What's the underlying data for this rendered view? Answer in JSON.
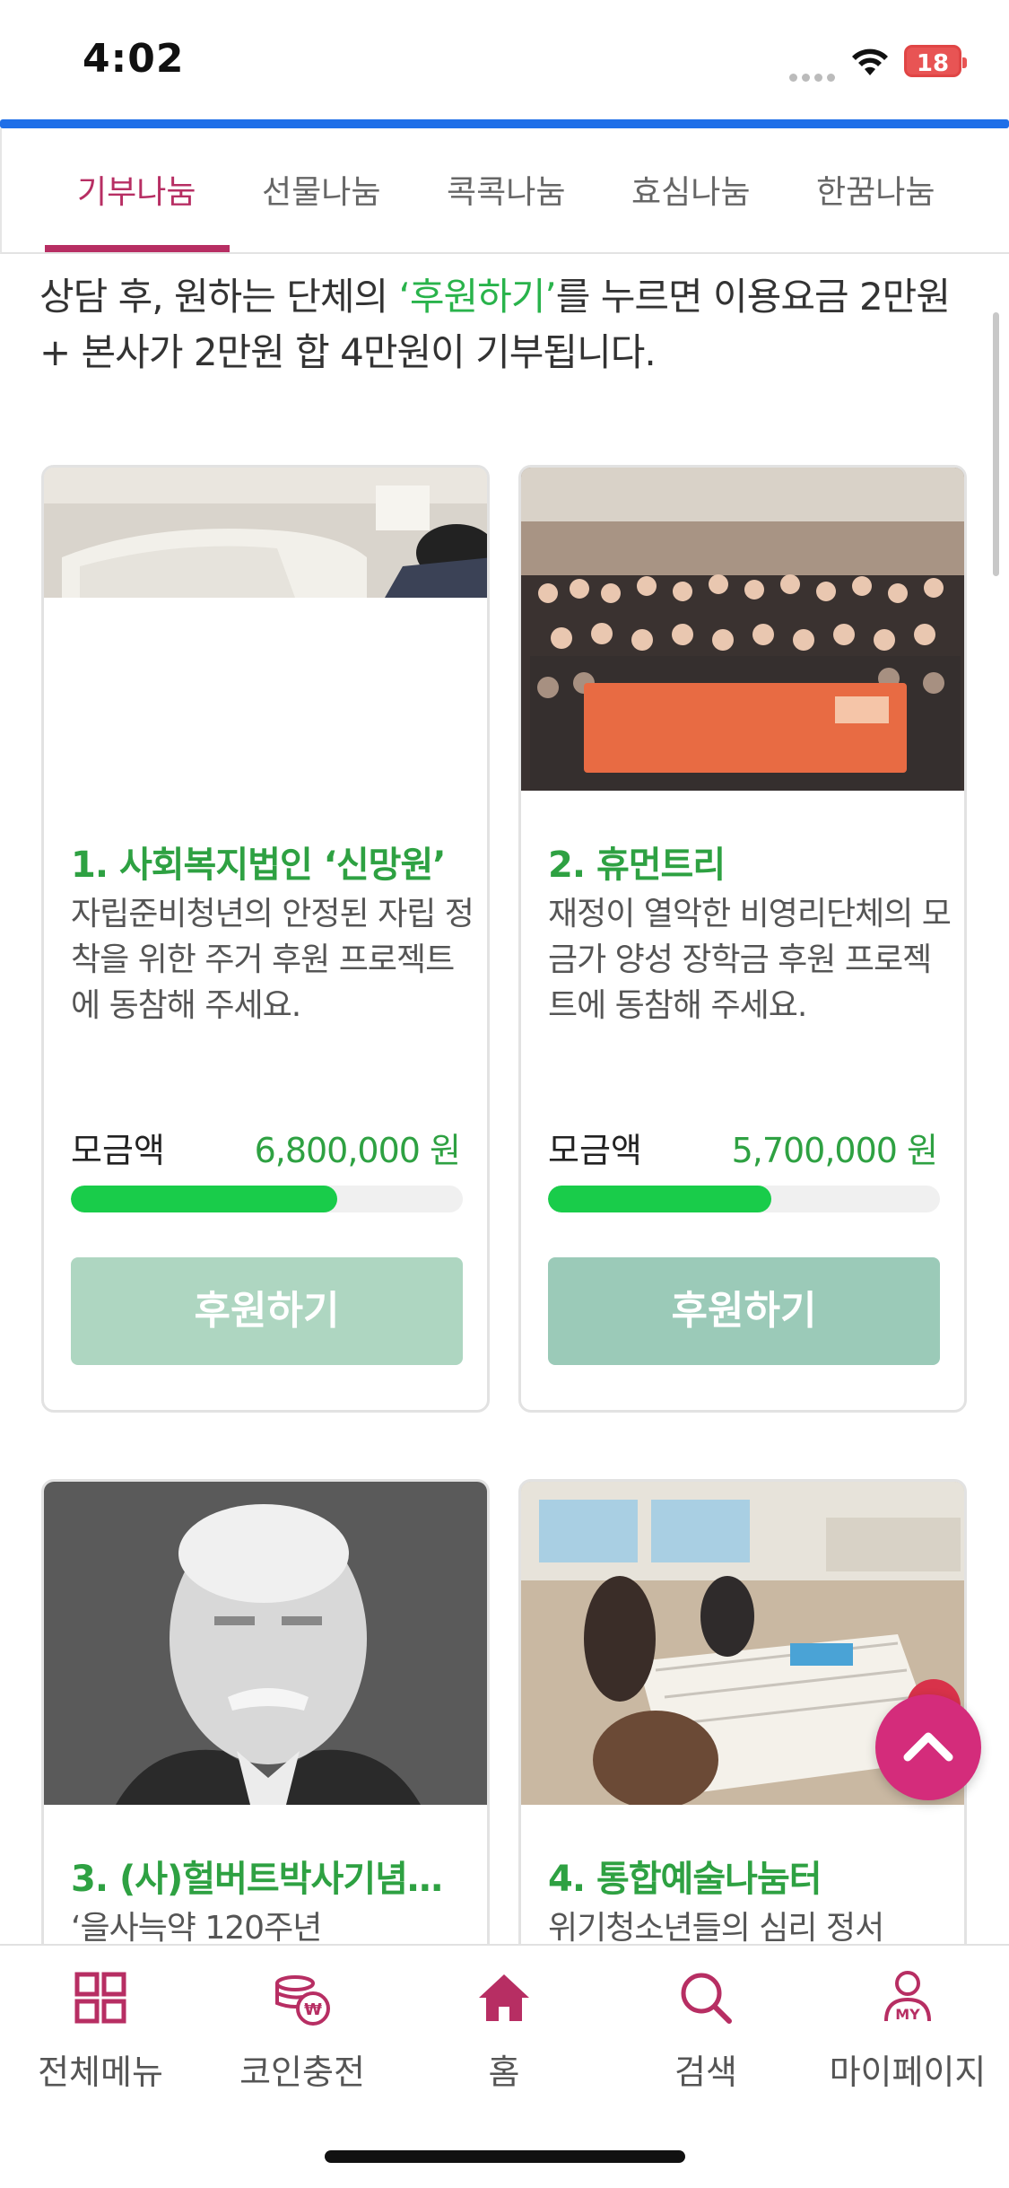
{
  "status_bar": {
    "time": "4:02",
    "battery": "18"
  },
  "tabs": [
    {
      "label": "기부나눔",
      "active": true
    },
    {
      "label": "선물나눔",
      "active": false
    },
    {
      "label": "콕콕나눔",
      "active": false
    },
    {
      "label": "효심나눔",
      "active": false
    },
    {
      "label": "한꿈나눔",
      "active": false
    }
  ],
  "intro": {
    "before": "상담 후, 원하는 단체의 ",
    "highlight": "‘후원하기’",
    "after": "를 누르면 이용요금 2만원 + 본사가 2만원 합 4만원이 기부됩니다."
  },
  "cards": [
    {
      "title": "1. 사회복지법인 ‘신망원’",
      "description": "자립준비청년의 안정된 자립 정착을 위한 주거 후원 프로젝트에 동참해 주세요.",
      "amount_label": "모금액",
      "amount": "6,800,000 원",
      "progress": 0.68,
      "button_label": "후원하기",
      "button_color": "#aed6c1"
    },
    {
      "title": "2. 휴먼트리",
      "description": "재정이 열악한 비영리단체의 모금가 양성 장학금 후원 프로젝트에 동참해 주세요.",
      "amount_label": "모금액",
      "amount": "5,700,000 원",
      "progress": 0.57,
      "button_label": "후원하기",
      "button_color": "#9bcab8"
    },
    {
      "title": "3. (사)헐버트박사기념…",
      "description": "‘을사늑약 120주년",
      "amount_label": "",
      "amount": "",
      "progress": null,
      "button_label": "",
      "button_color": ""
    },
    {
      "title": "4. 통합예술나눔터",
      "description": "위기청소년들의 심리 정서",
      "amount_label": "",
      "amount": "",
      "progress": null,
      "button_label": "",
      "button_color": ""
    }
  ],
  "bottom_nav": [
    {
      "label": "전체메뉴",
      "icon": "grid-icon"
    },
    {
      "label": "코인충전",
      "icon": "coin-charge-icon"
    },
    {
      "label": "홈",
      "icon": "home-icon"
    },
    {
      "label": "검색",
      "icon": "search-icon"
    },
    {
      "label": "마이페이지",
      "icon": "my-page-icon"
    }
  ],
  "colors": {
    "accent": "#b72e63",
    "green": "#2ea142",
    "progress_fill": "#19cc4a",
    "fab": "#d42c7b",
    "top_progress": "#1f6fe8"
  }
}
